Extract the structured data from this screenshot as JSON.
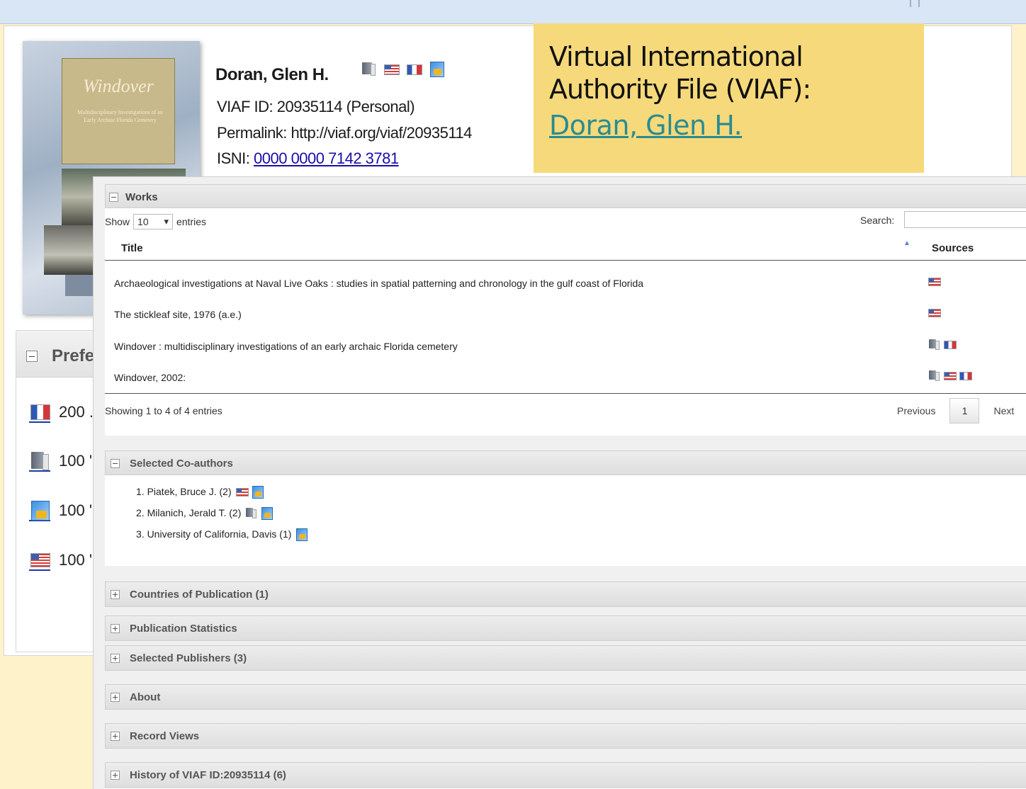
{
  "record": {
    "name": "Doran, Glen H.",
    "viaf_id": "VIAF ID: 20935114 (Personal)",
    "permalink": "Permalink: http://viaf.org/viaf/20935114",
    "isni_label": "ISNI: ",
    "isni_value": "0000 0000 7142 3781",
    "source_icons": [
      "book-icon",
      "us-flag-icon",
      "france-flag-icon",
      "nukat-icon"
    ]
  },
  "cover": {
    "title": "Windover",
    "subtitle": "Multidisciplinary Investigations of an Early Archaic Florida Cemetery"
  },
  "callout": {
    "line1": "Virtual International",
    "line2": "Authority File (VIAF):",
    "link": "Doran, Glen H."
  },
  "preferred": {
    "heading": "Prefe",
    "rows": [
      {
        "icon": "france-flag-icon",
        "value": "200 ."
      },
      {
        "icon": "book-icon",
        "value": "100 '"
      },
      {
        "icon": "nukat-icon",
        "value": "100 '"
      },
      {
        "icon": "us-flag-icon",
        "value": "100 '"
      }
    ]
  },
  "works": {
    "heading": "Works",
    "show_label": "Show",
    "show_value": "10",
    "entries_label": "entries",
    "search_label": "Search:",
    "col_title": "Title",
    "col_sources": "Sources",
    "rows": [
      {
        "title": "Archaeological investigations at Naval Live Oaks : studies in spatial patterning and chronology in the gulf coast of Florida",
        "sources": [
          "us-flag-icon"
        ]
      },
      {
        "title": "The stickleaf site, 1976 (a.e.)",
        "sources": [
          "us-flag-icon"
        ]
      },
      {
        "title": "Windover : multidisciplinary investigations of an early archaic Florida cemetery",
        "sources": [
          "book-icon",
          "france-flag-icon"
        ]
      },
      {
        "title": "Windover, 2002:",
        "sources": [
          "book-icon",
          "us-flag-icon",
          "france-flag-icon"
        ]
      }
    ],
    "showing": "Showing 1 to 4 of 4 entries",
    "previous": "Previous",
    "page": "1",
    "next": "Next"
  },
  "coauthors": {
    "heading": "Selected Co-authors",
    "items": [
      {
        "text": "1. Piatek, Bruce J. (2)",
        "icons": [
          "us-flag-icon",
          "nukat-icon"
        ]
      },
      {
        "text": "2. Milanich, Jerald T. (2)",
        "icons": [
          "book-icon",
          "nukat-icon"
        ]
      },
      {
        "text": "3. University of California, Davis (1)",
        "icons": [
          "nukat-icon"
        ]
      }
    ]
  },
  "sections": {
    "countries": "Countries of Publication (1)",
    "stats": "Publication Statistics",
    "publishers": "Selected Publishers (3)",
    "about": "About",
    "views": "Record Views",
    "history": "History of VIAF ID:20935114 (6)"
  }
}
